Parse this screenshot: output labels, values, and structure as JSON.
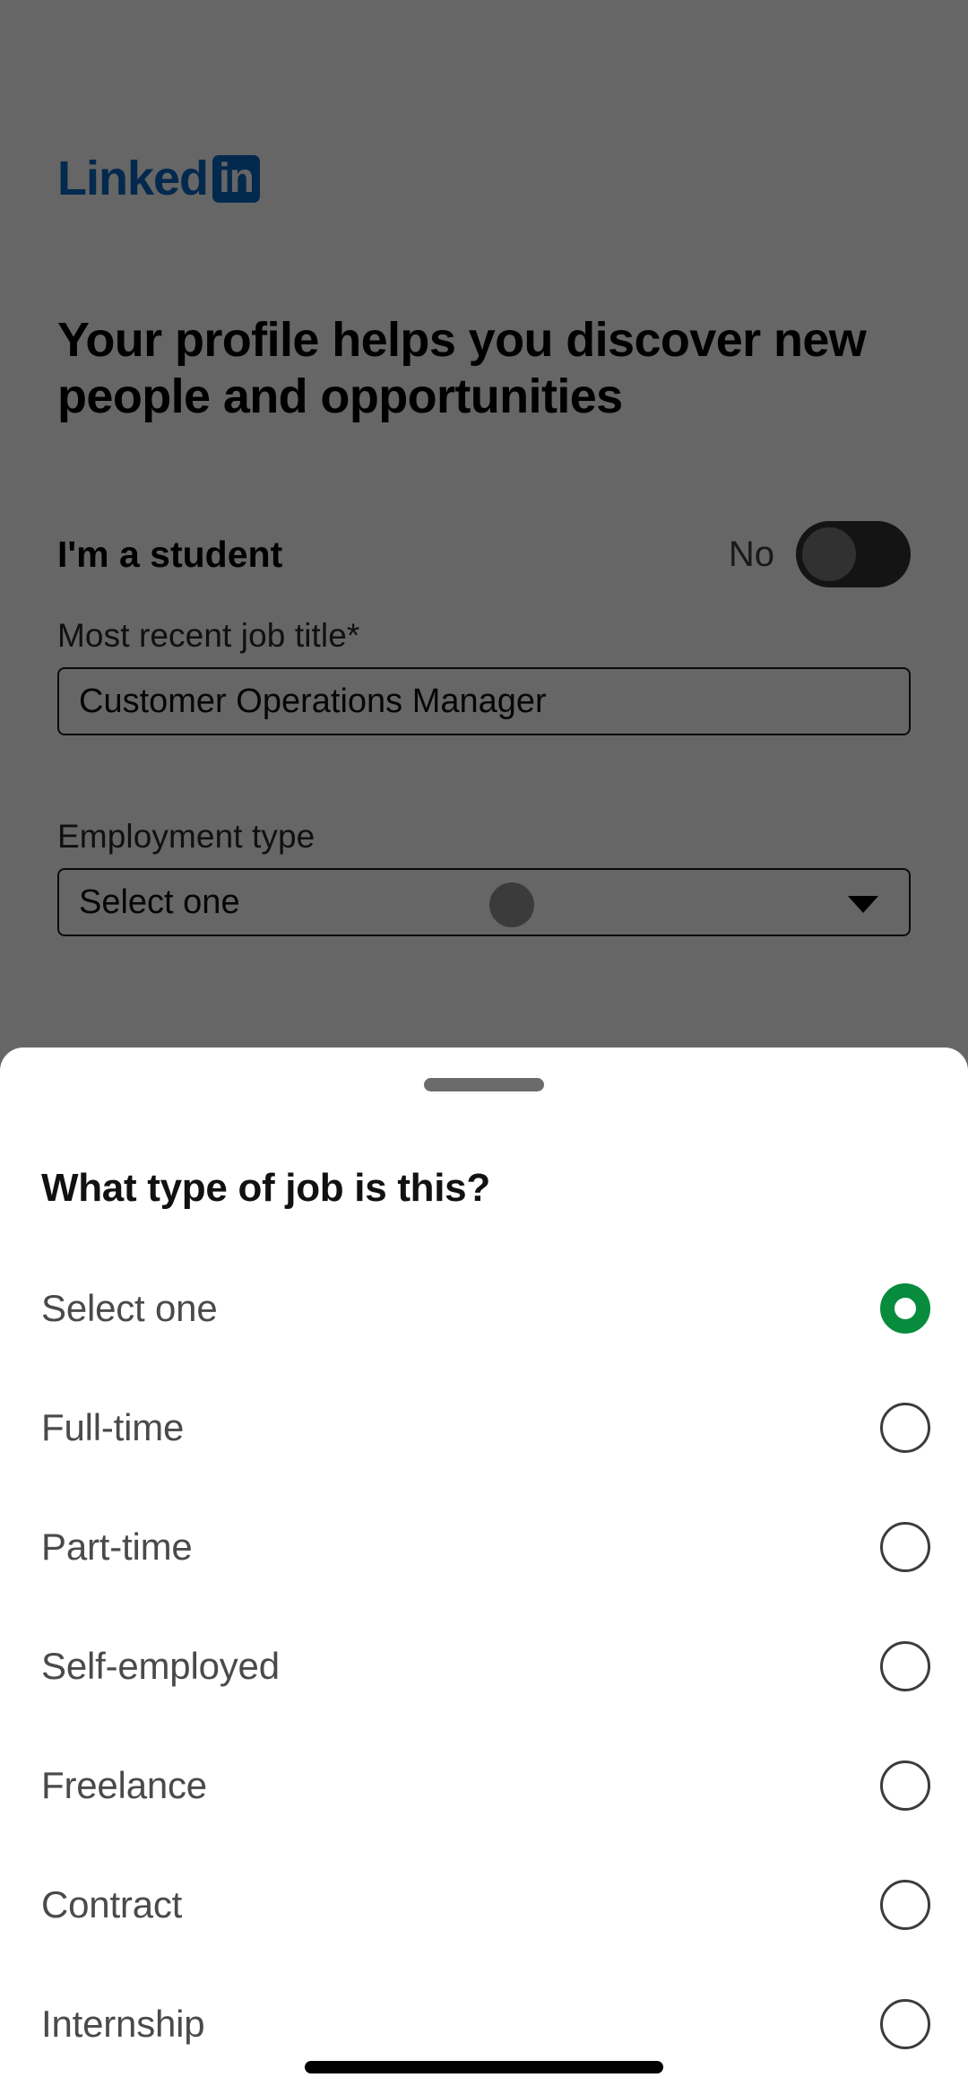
{
  "brand": {
    "logo_word": "Linked",
    "logo_badge": "in",
    "color": "#0a66c2"
  },
  "background_form": {
    "headline": "Your profile helps you discover new people and opportunities",
    "student_toggle": {
      "label": "I'm a student",
      "value": "No",
      "state": "off"
    },
    "fields": [
      {
        "label": "Most recent job title*",
        "value": "Customer Operations Manager",
        "type": "text"
      },
      {
        "label": "Employment type",
        "value": "Select one",
        "type": "select"
      },
      {
        "label": "",
        "value": "",
        "type": "text"
      }
    ]
  },
  "sheet": {
    "title": "What type of job is this?",
    "selected_value": "Select one",
    "accent_color": "#078b3c",
    "options": [
      {
        "label": "Select one",
        "selected": true
      },
      {
        "label": "Full-time",
        "selected": false
      },
      {
        "label": "Part-time",
        "selected": false
      },
      {
        "label": "Self-employed",
        "selected": false
      },
      {
        "label": "Freelance",
        "selected": false
      },
      {
        "label": "Contract",
        "selected": false
      },
      {
        "label": "Internship",
        "selected": false
      }
    ]
  }
}
